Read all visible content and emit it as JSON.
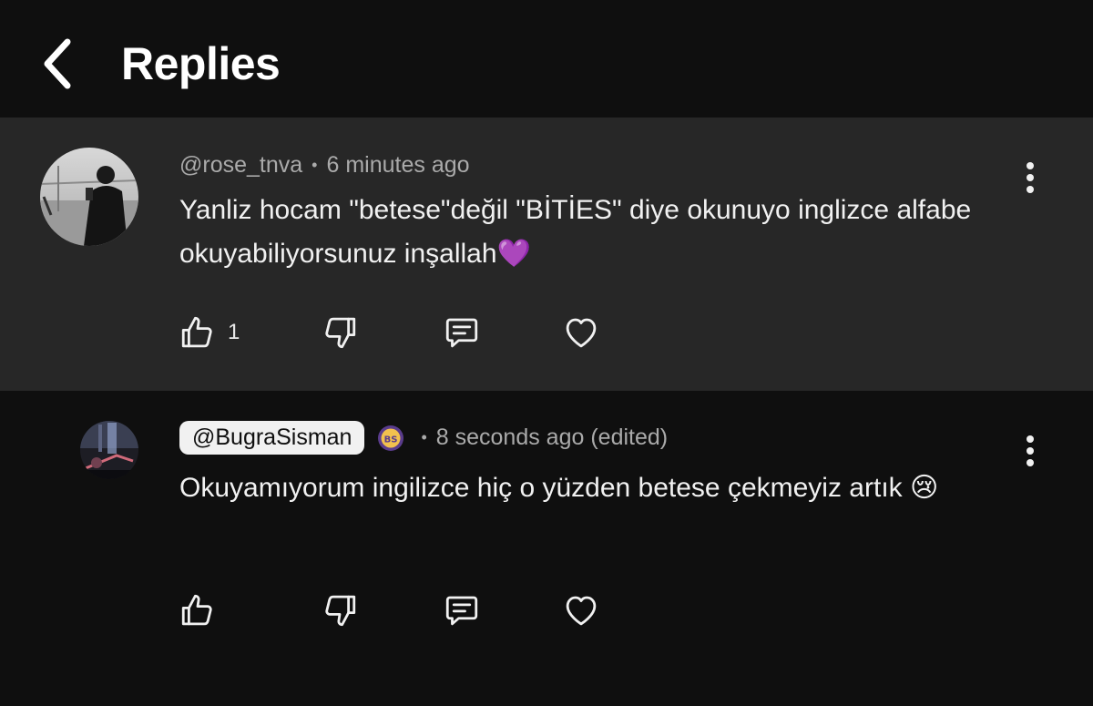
{
  "header": {
    "title": "Replies",
    "back_icon": "chevron-left-icon"
  },
  "comments": [
    {
      "author": "@rose_tnva",
      "separator": "•",
      "time": "6 minutes ago",
      "text": "Yanliz hocam \"betese\"değil \"BİTİES\" diye okunuyo inglizce alfabe okuyabiliyorsunuz inşallah💜",
      "like_count": "1",
      "icons": [
        "thumb-up-icon",
        "thumb-down-icon",
        "reply-icon",
        "heart-icon",
        "more-vert-icon"
      ]
    },
    {
      "author": "@BugraSisman",
      "separator": "•",
      "time": "8 seconds ago (edited)",
      "text": "Okuyamıyorum ingilizce hiç o yüzden betese çekmeyiz artık 😢",
      "like_count": "",
      "badge_icon": "channel-badge-icon",
      "badge_text": "BS",
      "icons": [
        "thumb-up-icon",
        "thumb-down-icon",
        "reply-icon",
        "heart-icon",
        "more-vert-icon"
      ]
    }
  ],
  "colors": {
    "background": "#0f0f0f",
    "highlight": "#272727",
    "secondary_text": "#aaaaaa",
    "primary_text": "#f1f1f1"
  }
}
